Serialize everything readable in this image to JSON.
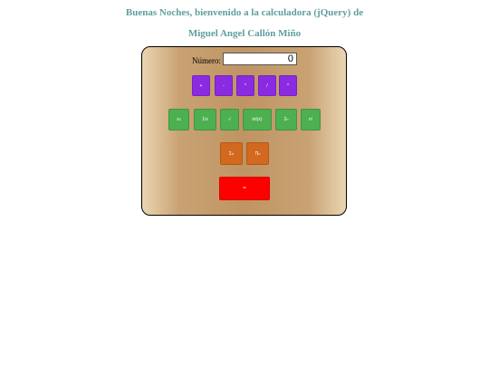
{
  "header": {
    "line1": "Buenas Noches, bienvenido a la calculadora (jQuery) de",
    "line2": "Miguel Angel Callón Miño"
  },
  "calculator": {
    "number_label": "Número:",
    "number_value": "0",
    "operators": {
      "add": "+",
      "subtract": "-",
      "multiply": "*",
      "divide": "/",
      "power": "^"
    },
    "functions": {
      "square_base": "x",
      "square_exp": "2",
      "reciprocal": "1/x",
      "sqrt": "√",
      "int": "int(x)",
      "pow2_base": "2",
      "pow2_exp": "n",
      "factorial": "n!"
    },
    "aggregates": {
      "sum_sym": "Σ",
      "sum_sub": "n",
      "product_sym": "Π",
      "product_sub": "n"
    },
    "equals": "="
  },
  "colors": {
    "heading": "#5f9ea0",
    "operator_buttons": "#8a2be2",
    "function_buttons": "#4caf50",
    "aggregate_buttons": "#d2691e",
    "equals_button": "#ff0000"
  }
}
